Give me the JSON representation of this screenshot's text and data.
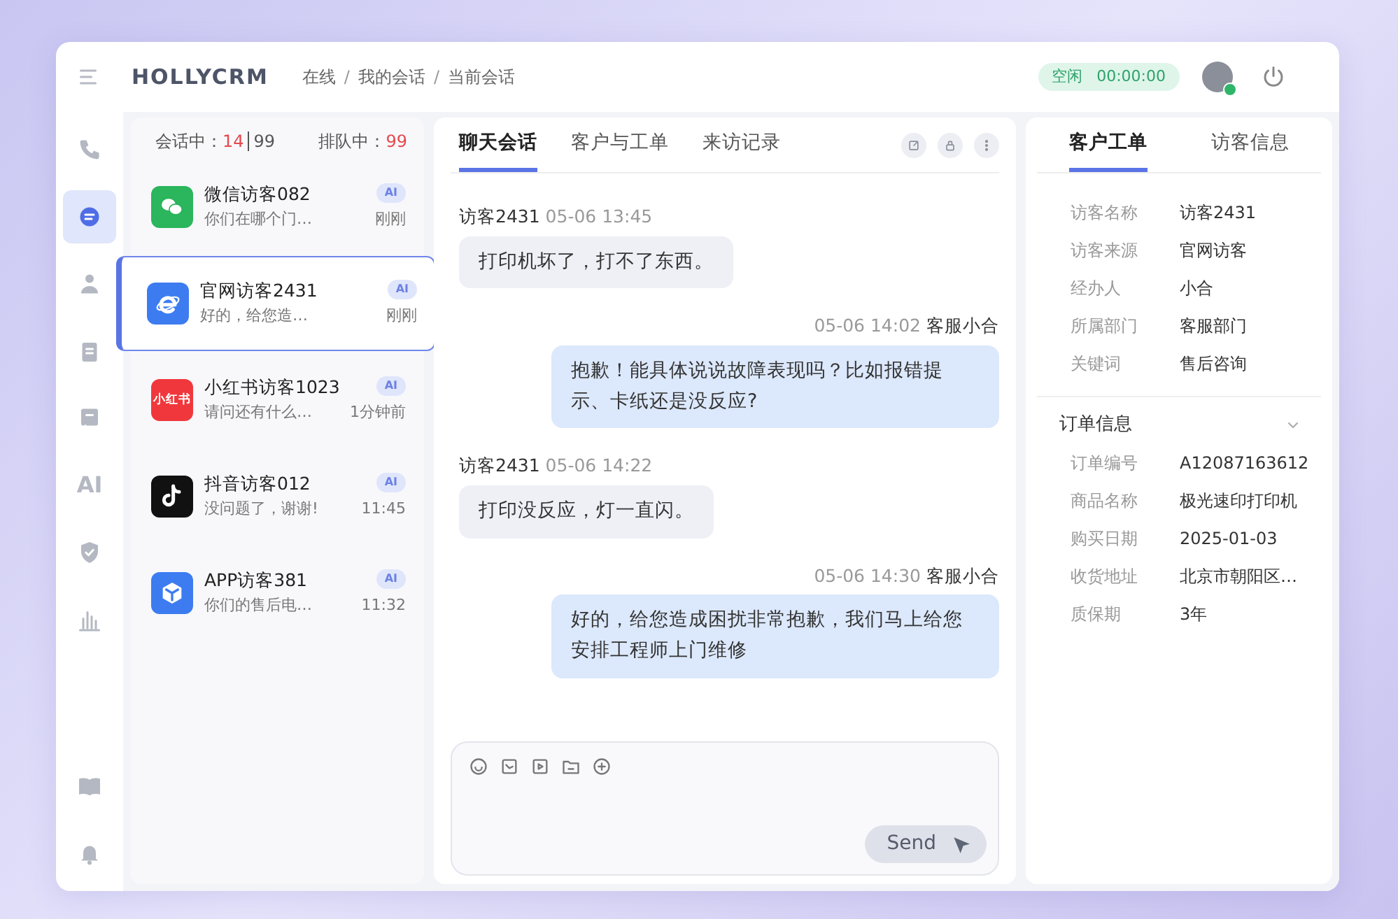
{
  "header": {
    "brand": "HOLLYCRM",
    "breadcrumb": [
      "在线",
      "我的会话",
      "当前会话"
    ],
    "breadcrumb_separator": "/",
    "status": {
      "label": "空闲",
      "timer": "00:00:00"
    },
    "avatar": {
      "online": true
    }
  },
  "rail": [
    {
      "kind": "phone",
      "selected": false
    },
    {
      "kind": "chat",
      "selected": true
    },
    {
      "kind": "user",
      "selected": false
    },
    {
      "kind": "clipboard",
      "selected": false
    },
    {
      "kind": "note",
      "selected": false
    },
    {
      "kind": "text",
      "label": "AI",
      "selected": false
    },
    {
      "kind": "shield",
      "selected": false
    },
    {
      "kind": "chart",
      "selected": false
    }
  ],
  "rail_bottom": [
    {
      "kind": "book",
      "selected": false
    },
    {
      "kind": "bell",
      "selected": false
    }
  ],
  "queue": {
    "active_label": "会话中：",
    "active": "14",
    "capacity": "99",
    "waiting_label": "排队中：",
    "waiting": "99"
  },
  "conversations": [
    {
      "kind": "wechat",
      "name": "微信访客082",
      "badge": "AI",
      "preview": "你们在哪个门…",
      "time": "刚刚",
      "selected": false
    },
    {
      "kind": "web",
      "name": "官网访客2431",
      "badge": "AI",
      "preview": "好的，给您造…",
      "time": "刚刚",
      "selected": true
    },
    {
      "kind": "xhs",
      "logo_text": "小红书",
      "name": "小红书访客1023",
      "badge": "AI",
      "preview": "请问还有什么…",
      "time": "1分钟前",
      "selected": false
    },
    {
      "kind": "douyin",
      "name": "抖音访客012",
      "badge": "AI",
      "preview": "没问题了，谢谢!",
      "time": "11:45",
      "selected": false
    },
    {
      "kind": "app",
      "name": "APP访客381",
      "badge": "AI",
      "preview": "你们的售后电…",
      "time": "11:32",
      "selected": false
    }
  ],
  "chat": {
    "tabs": [
      {
        "label": "聊天会话",
        "selected": true
      },
      {
        "label": "客户与工单",
        "selected": false
      },
      {
        "label": "来访记录",
        "selected": false
      }
    ],
    "messages": [
      {
        "kind": "visitor",
        "sender": "访客2431",
        "time": "05-06 13:45",
        "text": "打印机坏了，打不了东西。"
      },
      {
        "kind": "agent",
        "sender": "客服小合",
        "time": "05-06 14:02",
        "text": "抱歉！能具体说说故障表现吗？比如报错提示、卡纸还是没反应?"
      },
      {
        "kind": "visitor",
        "sender": "访客2431",
        "time": "05-06 14:22",
        "text": "打印没反应，灯一直闪。"
      },
      {
        "kind": "agent",
        "sender": "客服小合",
        "time": "05-06 14:30",
        "text": "好的，给您造成困扰非常抱歉，我们马上给您安排工程师上门维修"
      }
    ],
    "composer": {
      "send": "Send"
    }
  },
  "details": {
    "tabs": [
      {
        "label": "客户工单",
        "selected": true
      },
      {
        "label": "访客信息",
        "selected": false
      }
    ],
    "fields": [
      {
        "label": "访客名称",
        "value": "访客2431"
      },
      {
        "label": "访客来源",
        "value": "官网访客"
      },
      {
        "label": "经办人",
        "value": "小合"
      },
      {
        "label": "所属部门",
        "value": "客服部门"
      },
      {
        "label": "关键词",
        "value": "售后咨询"
      }
    ],
    "order": {
      "title": "订单信息",
      "expanded": true,
      "fields": [
        {
          "label": "订单编号",
          "value": "A12087163612"
        },
        {
          "label": "商品名称",
          "value": "极光速印打印机"
        },
        {
          "label": "购买日期",
          "value": "2025-01-03"
        },
        {
          "label": "收货地址",
          "value": "北京市朝阳区…"
        },
        {
          "label": "质保期",
          "value": "3年"
        }
      ]
    }
  }
}
